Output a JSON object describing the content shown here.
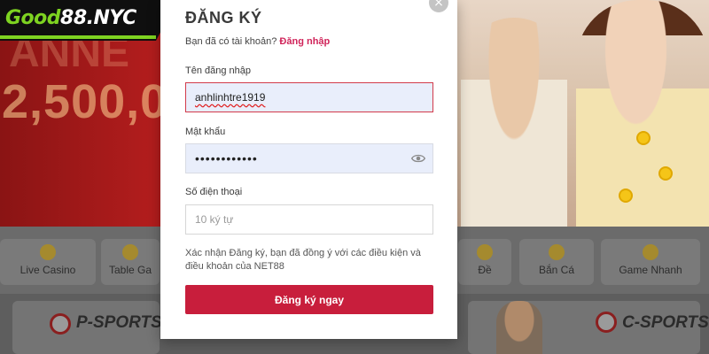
{
  "logo": {
    "part1": "Good",
    "part2": "88.NYC"
  },
  "banner": {
    "amount": "2,500,0",
    "faint": "ANNE"
  },
  "categories": [
    {
      "label": "Live Casino",
      "icon": "coin-icon"
    },
    {
      "label": "Table Ga",
      "icon": "cards-icon"
    },
    {
      "label": "Đề",
      "icon": "lottery-icon"
    },
    {
      "label": "Bắn Cá",
      "icon": "fish-icon"
    },
    {
      "label": "Game Nhanh",
      "icon": "dice-icon"
    }
  ],
  "sports": {
    "left": "P-SPORTS",
    "right": "C-SPORTS"
  },
  "modal": {
    "title": "ĐĂNG KÝ",
    "have_account": "Bạn đã có tài khoản?",
    "login_link": "Đăng nhập",
    "username_label": "Tên đăng nhập",
    "username_value": "anhlinhtre1919",
    "password_label": "Mật khẩu",
    "password_value": "••••••••••••",
    "phone_label": "Số điện thoại",
    "phone_placeholder": "10 ký tự",
    "terms": "Xác nhận Đăng ký, bạn đã đồng ý với các điều kiện và điều khoản của NET88",
    "submit_label": "Đăng ký ngay",
    "close_symbol": "×"
  },
  "colors": {
    "accent": "#c81e3c",
    "link": "#d0245a",
    "brand_green": "#7ed321"
  }
}
